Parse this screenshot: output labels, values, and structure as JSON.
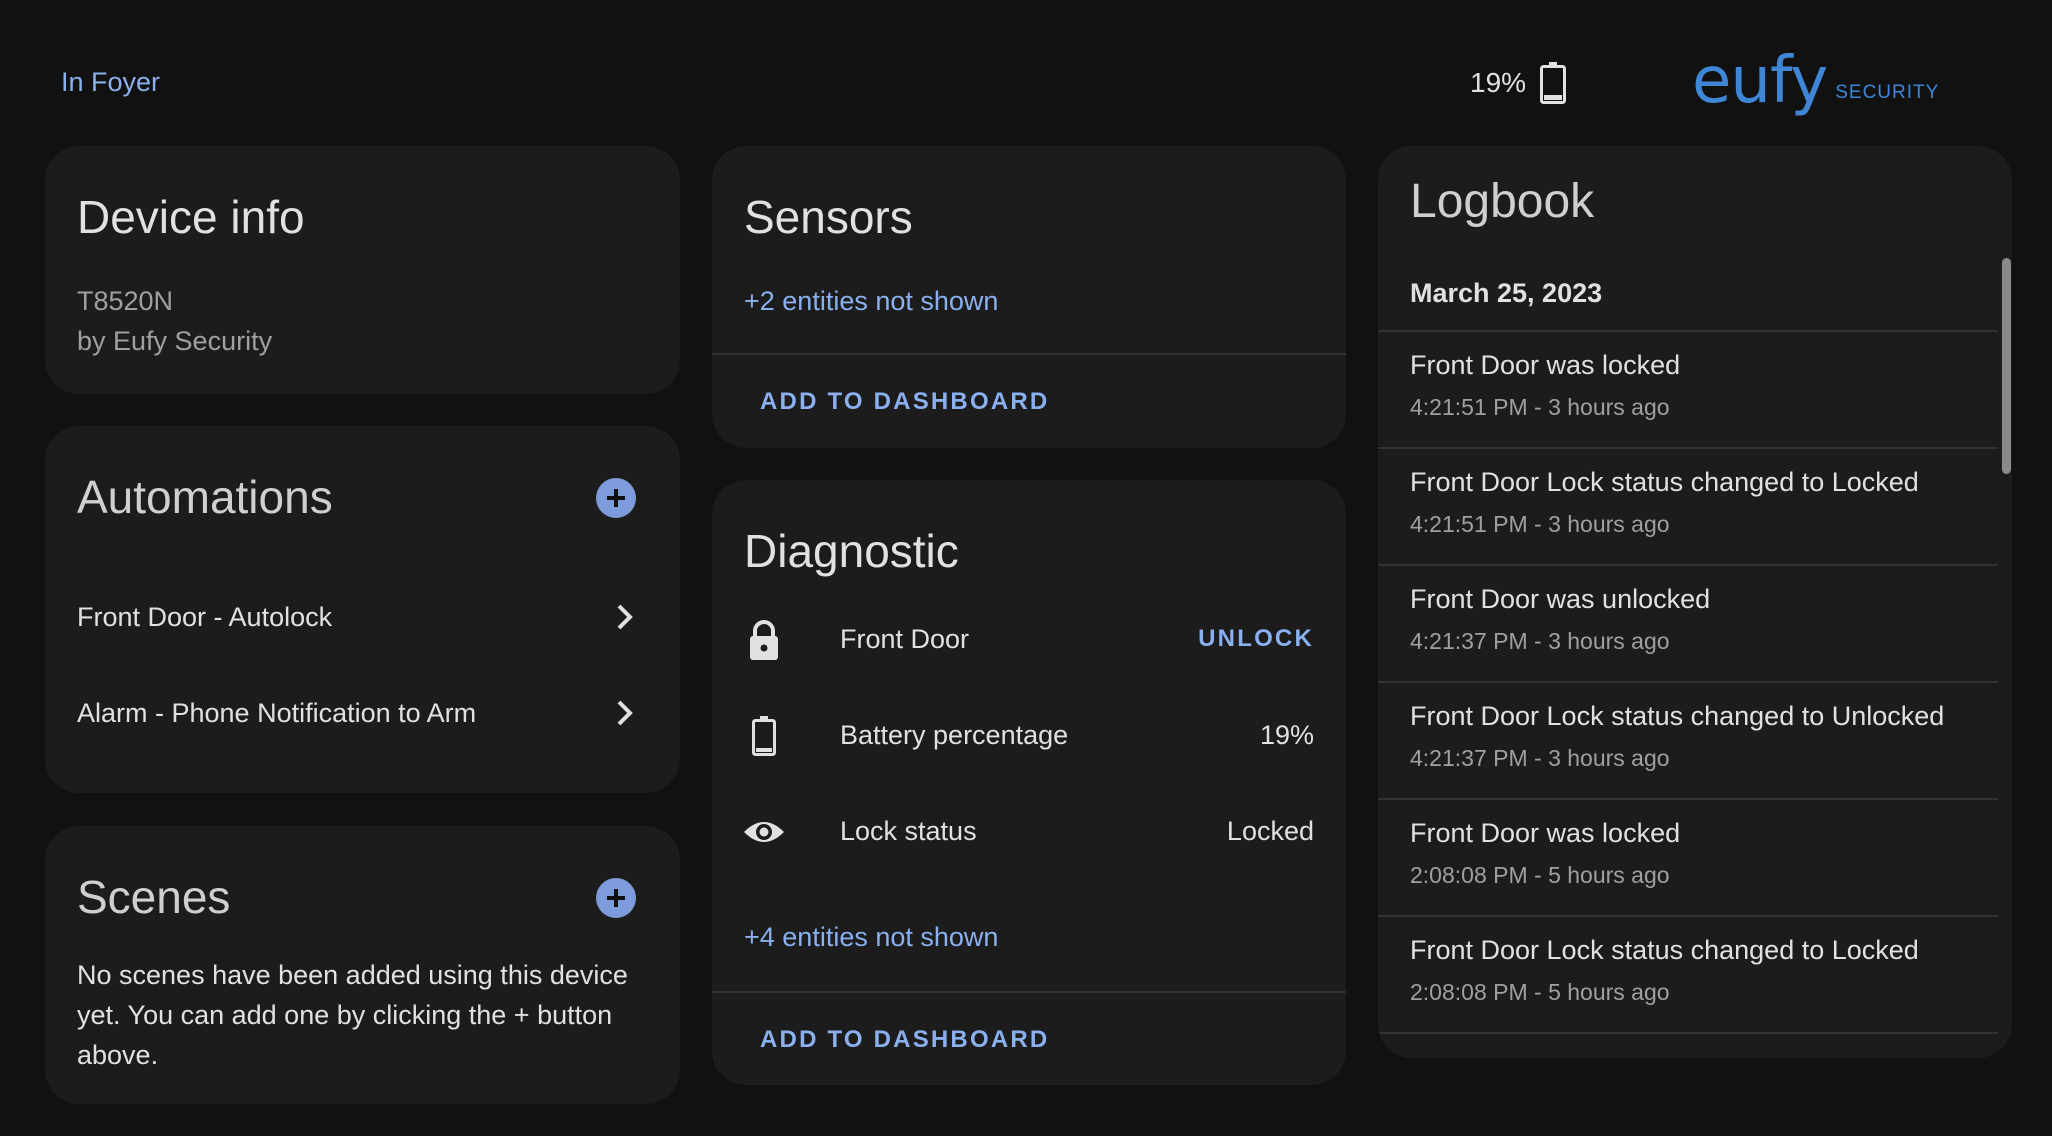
{
  "header": {
    "area": "In Foyer",
    "battery": "19%",
    "logo_brand": "eufy",
    "logo_sub": "SECURITY"
  },
  "device_info": {
    "title": "Device info",
    "model": "T8520N",
    "manufacturer": "by Eufy Security"
  },
  "automations": {
    "title": "Automations",
    "items": [
      {
        "label": "Front Door - Autolock"
      },
      {
        "label": "Alarm - Phone Notification to Arm"
      }
    ]
  },
  "scenes": {
    "title": "Scenes",
    "empty_text": "No scenes have been added using this device yet. You can add one by clicking the + button above."
  },
  "sensors": {
    "title": "Sensors",
    "hidden_entities": "+2 entities not shown",
    "add_label": "ADD TO DASHBOARD"
  },
  "diagnostic": {
    "title": "Diagnostic",
    "rows": [
      {
        "icon": "lock-icon",
        "name": "Front Door",
        "action": "UNLOCK"
      },
      {
        "icon": "battery-icon",
        "name": "Battery percentage",
        "value": "19%"
      },
      {
        "icon": "eye-icon",
        "name": "Lock status",
        "value": "Locked"
      }
    ],
    "hidden_entities": "+4 entities not shown",
    "add_label": "ADD TO DASHBOARD"
  },
  "logbook": {
    "title": "Logbook",
    "date": "March 25, 2023",
    "entries": [
      {
        "message": "Front Door was locked",
        "time": "4:21:51 PM - 3 hours ago"
      },
      {
        "message": "Front Door Lock status changed to Locked",
        "time": "4:21:51 PM - 3 hours ago"
      },
      {
        "message": "Front Door was unlocked",
        "time": "4:21:37 PM - 3 hours ago"
      },
      {
        "message": "Front Door Lock status changed to Unlocked",
        "time": "4:21:37 PM - 3 hours ago"
      },
      {
        "message": "Front Door was locked",
        "time": "2:08:08 PM - 5 hours ago"
      },
      {
        "message": "Front Door Lock status changed to Locked",
        "time": "2:08:08 PM - 5 hours ago"
      }
    ]
  },
  "colors": {
    "background": "#111111",
    "card": "#1c1c1c",
    "accent": "#8ab0f0",
    "add_button": "#7e9cdb",
    "logo": "#3f86d6"
  }
}
